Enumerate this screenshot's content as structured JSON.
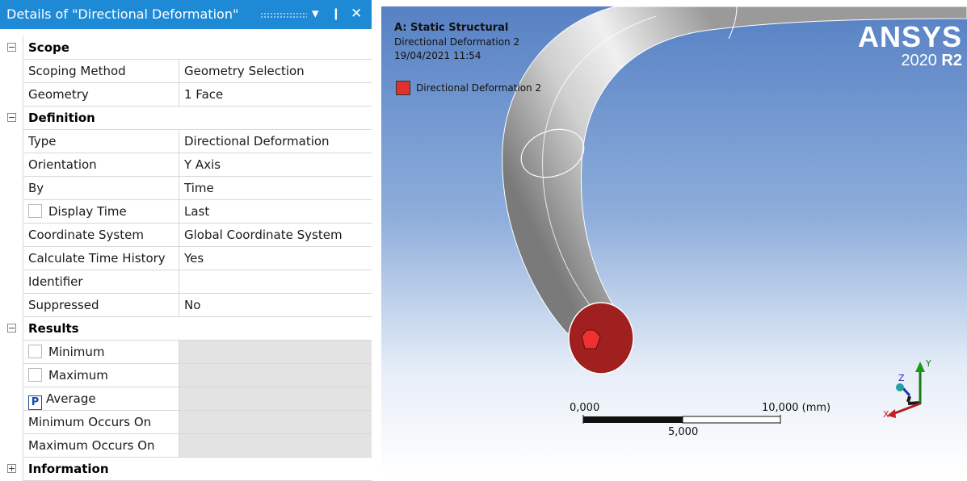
{
  "panel": {
    "title": "Details of \"Directional Deformation\"",
    "dropdown_icon": "▾",
    "pin_icon": "❙",
    "close_icon": "✕"
  },
  "groups": {
    "scope": {
      "label": "Scope",
      "expander": "−",
      "rows": [
        {
          "prop": "Scoping Method",
          "value": "Geometry Selection"
        },
        {
          "prop": "Geometry",
          "value": "1 Face"
        }
      ]
    },
    "definition": {
      "label": "Definition",
      "expander": "−",
      "rows": [
        {
          "prop": "Type",
          "value": "Directional Deformation"
        },
        {
          "prop": "Orientation",
          "value": "Y Axis"
        },
        {
          "prop": "By",
          "value": "Time"
        },
        {
          "prop": "Display Time",
          "value": "Last",
          "checkbox": true
        },
        {
          "prop": "Coordinate System",
          "value": "Global Coordinate System"
        },
        {
          "prop": "Calculate Time History",
          "value": "Yes"
        },
        {
          "prop": "Identifier",
          "value": ""
        },
        {
          "prop": "Suppressed",
          "value": "No"
        }
      ]
    },
    "results": {
      "label": "Results",
      "expander": "−",
      "rows": [
        {
          "prop": "Minimum",
          "value": "",
          "checkbox": true
        },
        {
          "prop": "Maximum",
          "value": "",
          "checkbox": true
        },
        {
          "prop": "Average",
          "value": "",
          "param_marker": "P"
        },
        {
          "prop": "Minimum Occurs On",
          "value": ""
        },
        {
          "prop": "Maximum Occurs On",
          "value": ""
        }
      ]
    },
    "information": {
      "label": "Information",
      "expander": "+"
    }
  },
  "viewport": {
    "analysis_title": "A: Static Structural",
    "result_name": "Directional Deformation 2",
    "timestamp": "19/04/2021 11:54",
    "legend_label": "Directional Deformation 2",
    "legend_color": "#e03030",
    "brand": "ANSYS",
    "version_prefix": "2020",
    "version_suffix": "R2",
    "scale": {
      "left_label": "0,000",
      "right_label": "10,000 (mm)",
      "mid_label": "5,000"
    },
    "triad": {
      "x": "X",
      "y": "Y",
      "z": "Z"
    },
    "colors": {
      "background_top": "#5781c4",
      "background_bottom": "#ffffff",
      "selected_face": "#a0201f",
      "tube": "#bdbdbd"
    }
  }
}
